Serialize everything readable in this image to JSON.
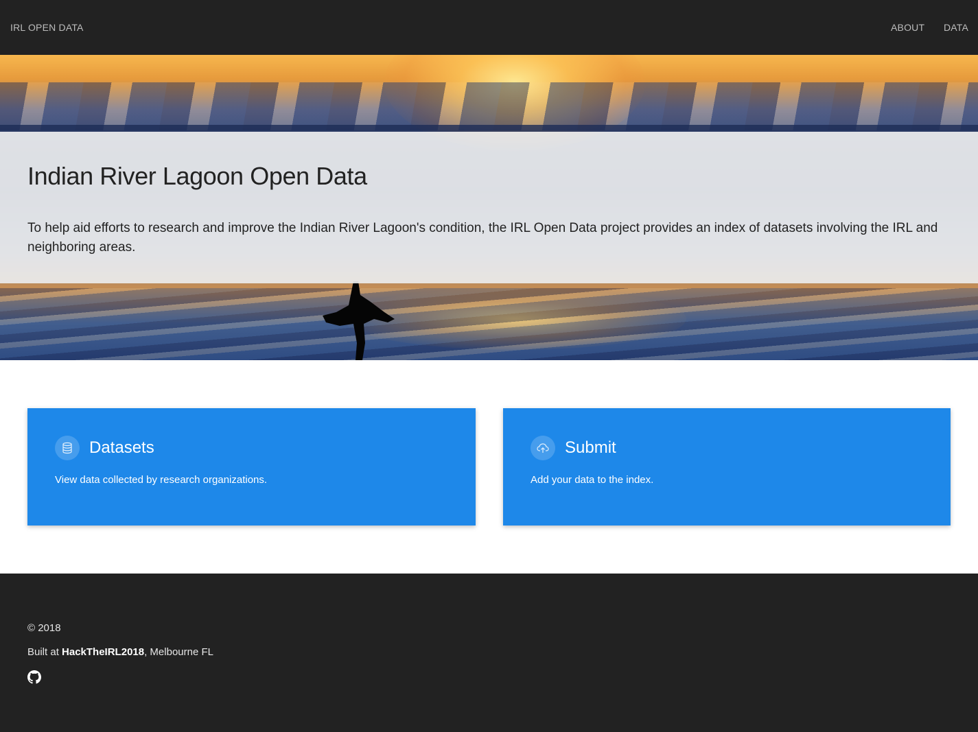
{
  "navbar": {
    "brand": "IRL OPEN DATA",
    "links": [
      {
        "label": "ABOUT"
      },
      {
        "label": "DATA"
      }
    ]
  },
  "hero": {
    "title": "Indian River Lagoon Open Data",
    "lead": "To help aid efforts to research and improve the Indian River Lagoon's condition, the IRL Open Data project provides an index of datasets involving the IRL and neighboring areas."
  },
  "cards": [
    {
      "title": "Datasets",
      "text": "View data collected by research organizations.",
      "icon": "database-icon"
    },
    {
      "title": "Submit",
      "text": "Add your data to the index.",
      "icon": "cloud-upload-icon"
    }
  ],
  "footer": {
    "copyright": "© 2018",
    "built_prefix": "Built at ",
    "built_event": "HackTheIRL2018",
    "built_suffix": ", Melbourne FL",
    "icon": "github-icon"
  },
  "colors": {
    "navbar_bg": "#222222",
    "card_bg": "#1e88e9",
    "footer_bg": "#222222",
    "jumbotron_bg": "#ececec"
  }
}
